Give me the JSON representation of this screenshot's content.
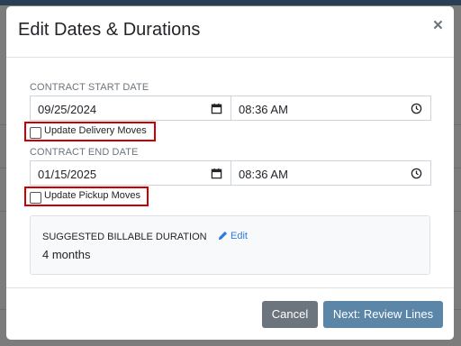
{
  "modal": {
    "title": "Edit Dates & Durations",
    "close_glyph": "×"
  },
  "contract_start": {
    "label": "CONTRACT START DATE",
    "date": "09/25/2024",
    "time": "08:36  AM",
    "checkbox_label": "Update Delivery Moves",
    "checked": false
  },
  "contract_end": {
    "label": "CONTRACT END DATE",
    "date": "01/15/2025",
    "time": "08:36  AM",
    "checkbox_label": "Update Pickup Moves",
    "checked": false
  },
  "duration": {
    "label": "SUGGESTED BILLABLE DURATION",
    "edit_label": "Edit",
    "value": "4 months"
  },
  "footer": {
    "cancel_label": "Cancel",
    "next_label": "Next: Review Lines"
  },
  "icons": {
    "calendar": "calendar-icon",
    "clock": "clock-icon",
    "pencil": "pencil-icon"
  },
  "colors": {
    "highlight_border": "#cc0000",
    "link": "#2c7be5",
    "cancel_button": "#6c757d",
    "primary_button": "#5b86a8",
    "backdrop": "#7c7c7c"
  }
}
